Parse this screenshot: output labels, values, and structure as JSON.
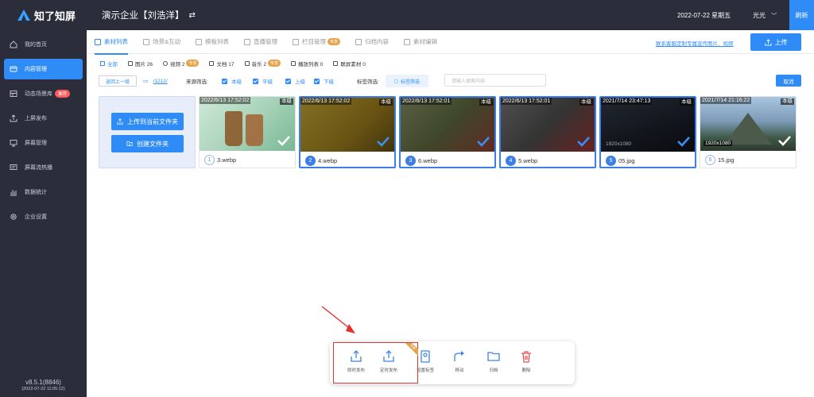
{
  "app": {
    "name": "知了知屏"
  },
  "sidebar": {
    "items": [
      {
        "label": "我的首页",
        "icon": "home-icon"
      },
      {
        "label": "内容管理",
        "icon": "content-icon",
        "active": true
      },
      {
        "label": "动态场景库",
        "icon": "scene-icon",
        "badge": "推荐"
      },
      {
        "label": "上屏发布",
        "icon": "publish-icon"
      },
      {
        "label": "屏幕管理",
        "icon": "monitor-icon"
      },
      {
        "label": "屏幕流热播",
        "icon": "screen-icon"
      },
      {
        "label": "数据统计",
        "icon": "chart-icon"
      },
      {
        "label": "企业设置",
        "icon": "gear-icon"
      }
    ],
    "version": "v8.5.1(8846)",
    "version_date": "(2022-07-22 11:05:12)"
  },
  "topbar": {
    "company": "演示企业【刘浩洋】",
    "date": "2022-07-22 星期五",
    "user": "光光",
    "refresh": "刷新"
  },
  "tabs": [
    {
      "label": "素材列表",
      "active": true
    },
    {
      "label": "场景&互动"
    },
    {
      "label": "模板列表"
    },
    {
      "label": "直播管理"
    },
    {
      "label": "栏目管理",
      "vip": "专享"
    },
    {
      "label": "归档内容"
    },
    {
      "label": "素材编辑"
    }
  ],
  "header": {
    "contact_link": "联系客服定制专属宣传图片、视频",
    "upload_label": "上传"
  },
  "filters": [
    {
      "label": "全部",
      "active": true
    },
    {
      "label": "图片 26"
    },
    {
      "label": "视频 2",
      "vip": "专享"
    },
    {
      "label": "文档 17"
    },
    {
      "label": "音乐 2",
      "vip": "专享"
    },
    {
      "label": "播放列表 0"
    },
    {
      "label": "联屏素材 0"
    }
  ],
  "row2": {
    "back": "返回上一级",
    "path": "/1212/",
    "source_label": "来源筛选:",
    "sources": [
      "本级",
      "平级",
      "上级",
      "下级"
    ],
    "tag_label": "标签筛选:",
    "tag_button": "标签筛选",
    "search_placeholder": "请输入搜索内容",
    "cancel": "取消"
  },
  "folder": {
    "upload_here": "上传到当前文件夹",
    "create_folder": "创建文件夹"
  },
  "cards": [
    {
      "num": "1",
      "name": "3.webp",
      "time": "2022/6/13 17:52:02",
      "level": "本级",
      "selected": false,
      "color": "#b7d6c3"
    },
    {
      "num": "2",
      "name": "4.webp",
      "time": "2022/6/13 17:52:02",
      "level": "本级",
      "selected": true,
      "color": "#c8a62c"
    },
    {
      "num": "3",
      "name": "6.webp",
      "time": "2022/6/13 17:52:01",
      "level": "本级",
      "selected": true,
      "color": "#7d8b5a"
    },
    {
      "num": "4",
      "name": "5.webp",
      "time": "2022/6/13 17:52:01",
      "level": "本级",
      "selected": true,
      "color": "#6a6a6a"
    },
    {
      "num": "5",
      "name": "05.jpg",
      "time": "2021/7/14 23:47:13",
      "level": "本级",
      "selected": true,
      "color": "#2a3140",
      "resolution": "1920x1080"
    },
    {
      "num": "6",
      "name": "15.jpg",
      "time": "2021/7/14 21:16:22",
      "level": "本级",
      "selected": false,
      "color": "#6c8fae",
      "resolution": "1920x1080"
    }
  ],
  "toolbar": {
    "items": [
      {
        "label": "即时发布",
        "icon": "upload-icon"
      },
      {
        "label": "定时发布",
        "icon": "upload-icon",
        "vip": "专享"
      },
      {
        "label": "设置标签",
        "icon": "tag-icon"
      },
      {
        "label": "移动",
        "icon": "share-icon"
      },
      {
        "label": "归档",
        "icon": "folder-icon"
      },
      {
        "label": "删除",
        "icon": "trash-icon"
      }
    ]
  },
  "colors": {
    "accent": "#2f8cf6",
    "sidebar": "#2b2d3b",
    "vip": "#e5a44a",
    "highlight": "#e2302d"
  }
}
